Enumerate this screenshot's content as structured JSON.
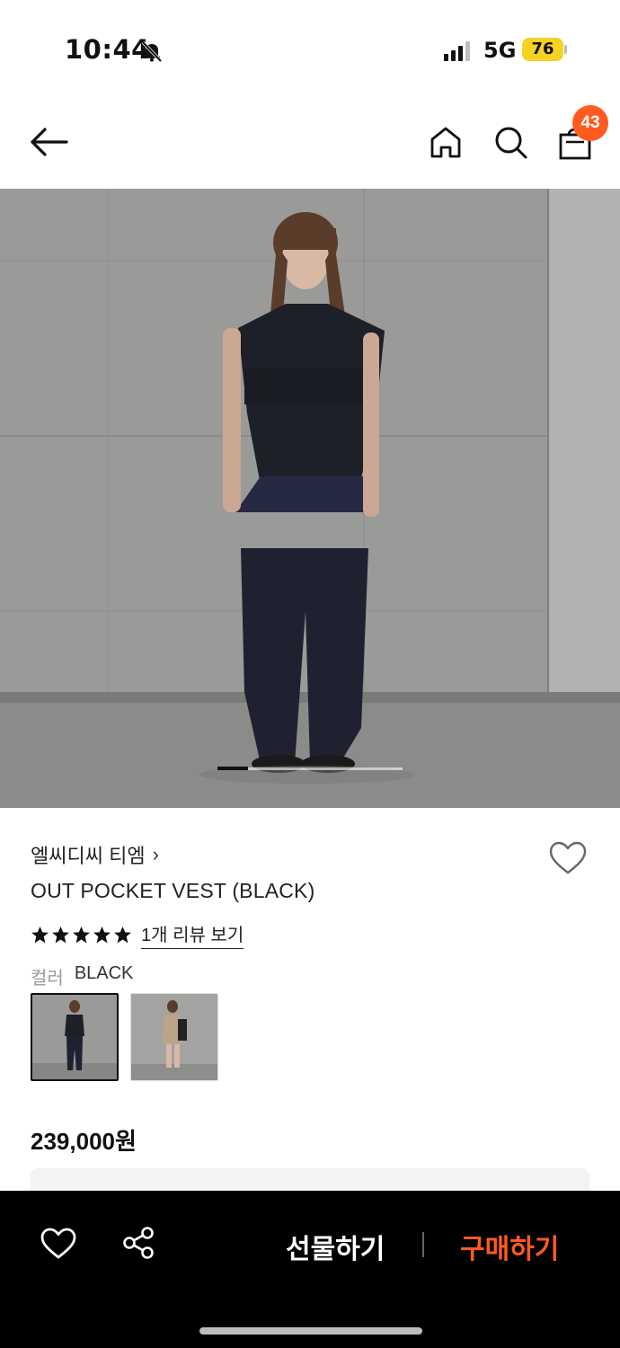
{
  "status_bar": {
    "time": "10:44",
    "network": "5G",
    "battery": "76"
  },
  "header": {
    "cart_count": "43"
  },
  "gallery": {
    "current_index": 1,
    "total": 6
  },
  "product": {
    "brand": "엘씨디씨 티엠",
    "brand_chevron": "›",
    "name": "OUT POCKET VEST (BLACK)",
    "rating": 5,
    "review_link": "1개 리뷰 보기",
    "color_key": "컬러",
    "color_value": "BLACK",
    "price": "239,000원"
  },
  "bottom_bar": {
    "gift_label": "선물하기",
    "buy_label": "구매하기"
  },
  "colors": {
    "accent": "#ff5a1f",
    "battery": "#f5d320"
  }
}
